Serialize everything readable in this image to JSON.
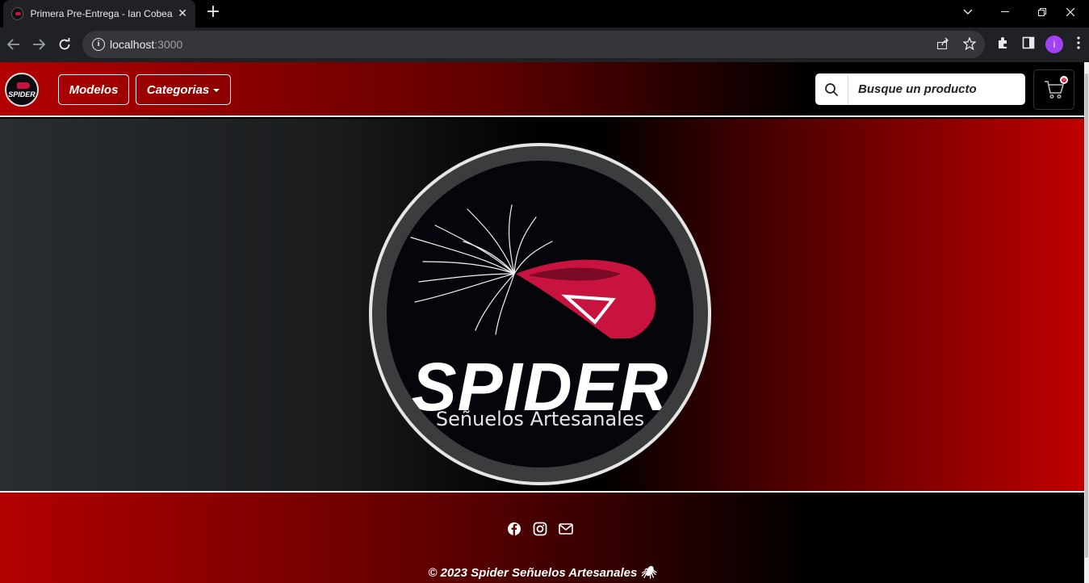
{
  "browser": {
    "tab_title": "Primera Pre-Entrega - Ian Cobeac",
    "tab_close": "✕",
    "new_tab": "+",
    "url_host": "localhost",
    "url_port": ":3000",
    "profile_initial": "i"
  },
  "navbar": {
    "models_label": "Modelos",
    "categories_label": "Categorias",
    "search_placeholder": "Busque un producto",
    "logo_text": "SPIDER",
    "cart_count": "0"
  },
  "hero": {
    "title": "SPIDER",
    "subtitle": "Señuelos Artesanales"
  },
  "footer": {
    "social_icons": [
      "facebook-icon",
      "instagram-icon",
      "mail-icon"
    ],
    "copyright": "© 2023 Spider Señuelos Artesanales 🕷"
  },
  "colors": {
    "brand_red": "#b30000",
    "lure_pink": "#c8133f"
  }
}
